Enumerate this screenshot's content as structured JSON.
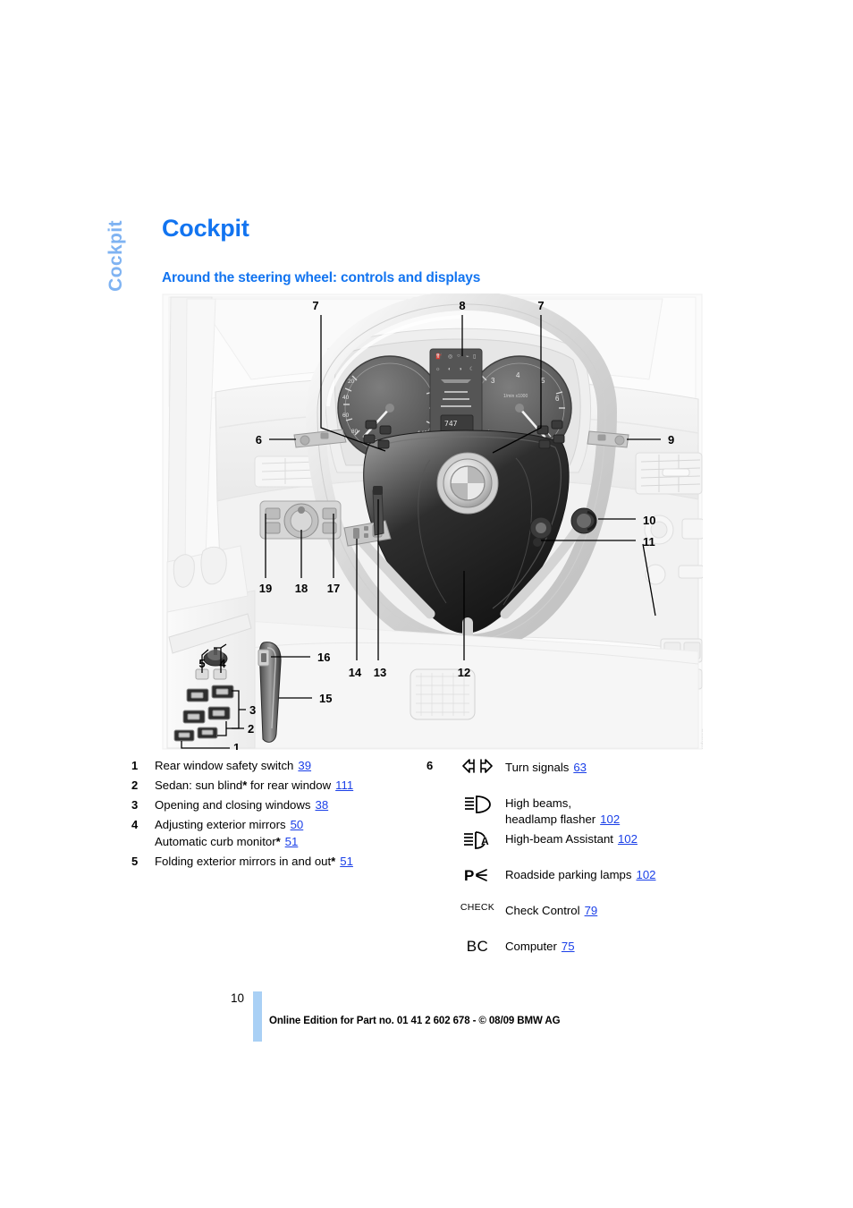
{
  "side_tab": {
    "label": "Cockpit"
  },
  "page_title": "Cockpit",
  "section_title": "Around the steering wheel: controls and displays",
  "colors": {
    "heading_blue": "#1274F0",
    "side_tab_blue": "#7FB3F2",
    "page_ref_blue": "#1A3FE8",
    "page_bar_blue": "#A9D0F5"
  },
  "illustration": {
    "alt": "BMW cockpit: steering wheel, instrument cluster, door panel controls",
    "credit": "Cockpit",
    "callouts": [
      {
        "id": "callout-1",
        "label": "1"
      },
      {
        "id": "callout-2",
        "label": "2"
      },
      {
        "id": "callout-3",
        "label": "3"
      },
      {
        "id": "callout-4",
        "label": "4"
      },
      {
        "id": "callout-5",
        "label": "5"
      },
      {
        "id": "callout-6",
        "label": "6"
      },
      {
        "id": "callout-7a",
        "label": "7"
      },
      {
        "id": "callout-7b",
        "label": "7"
      },
      {
        "id": "callout-8",
        "label": "8"
      },
      {
        "id": "callout-9",
        "label": "9"
      },
      {
        "id": "callout-10",
        "label": "10"
      },
      {
        "id": "callout-11",
        "label": "11"
      },
      {
        "id": "callout-12",
        "label": "12"
      },
      {
        "id": "callout-13",
        "label": "13"
      },
      {
        "id": "callout-14",
        "label": "14"
      },
      {
        "id": "callout-15",
        "label": "15"
      },
      {
        "id": "callout-16",
        "label": "16"
      },
      {
        "id": "callout-17",
        "label": "17"
      },
      {
        "id": "callout-18",
        "label": "18"
      },
      {
        "id": "callout-19",
        "label": "19"
      }
    ]
  },
  "legend": {
    "left": [
      {
        "number": "1",
        "lines": [
          {
            "text": "Rear window safety switch",
            "star": false,
            "page": "39"
          }
        ]
      },
      {
        "number": "2",
        "lines": [
          {
            "text": "Sedan: sun blind",
            "star": true,
            "text_after": " for rear window",
            "page": "111"
          }
        ]
      },
      {
        "number": "3",
        "lines": [
          {
            "text": "Opening and closing windows",
            "star": false,
            "page": "38"
          }
        ]
      },
      {
        "number": "4",
        "lines": [
          {
            "text": "Adjusting exterior mirrors",
            "star": false,
            "page": "50"
          },
          {
            "text": "Automatic curb monitor",
            "star": true,
            "page": "51"
          }
        ]
      },
      {
        "number": "5",
        "lines": [
          {
            "text": "Folding exterior mirrors in and out",
            "star": true,
            "page": "51"
          }
        ]
      }
    ],
    "right": {
      "number": "6",
      "items": [
        {
          "icon": "turn-signals-icon",
          "label": "Turn signals",
          "label2": "",
          "page": "63"
        },
        {
          "icon": "high-beam-icon",
          "label": "High beams,",
          "label2": "headlamp flasher",
          "page": "102"
        },
        {
          "icon": "high-beam-assistant-icon",
          "label": "High-beam Assistant",
          "label2": "",
          "page": "102"
        },
        {
          "icon": "parking-lamps-icon",
          "label": "Roadside parking lamps",
          "label2": "",
          "page": "102"
        },
        {
          "icon": "check-control-icon",
          "label": "Check Control",
          "label2": "",
          "page": "79",
          "icon_text": "CHECK"
        },
        {
          "icon": "computer-icon",
          "label": "Computer",
          "label2": "",
          "page": "75",
          "icon_text": "BC"
        }
      ]
    }
  },
  "footer": {
    "page_number": "10",
    "text": "Online Edition for Part no. 01 41 2 602 678 - © 08/09 BMW AG"
  }
}
